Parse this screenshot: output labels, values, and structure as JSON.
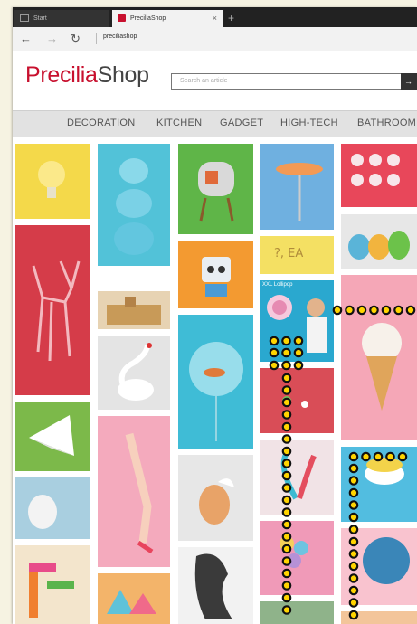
{
  "browser": {
    "tabs": [
      {
        "label": "Start",
        "icon": "page-icon"
      },
      {
        "label": "PreciliaShop",
        "icon": "site-favicon-icon"
      }
    ],
    "close_symbol": "×",
    "new_tab_symbol": "+",
    "back_symbol": "←",
    "forward_symbol": "→",
    "refresh_symbol": "↻",
    "url": "preciliashop"
  },
  "site": {
    "logo_part1": "Precilia",
    "logo_part2": "Shop",
    "search_placeholder": "Search an article",
    "search_button": "→",
    "brand_color": "#c8102e"
  },
  "menu": [
    "DECORATION",
    "KITCHEN",
    "GADGET",
    "HIGH-TECH",
    "BATHROOM"
  ],
  "products": {
    "tile_text_1": "?, EA",
    "tile_text_2": "XXL Lollipop"
  },
  "tour_path_color": "#ffd400"
}
